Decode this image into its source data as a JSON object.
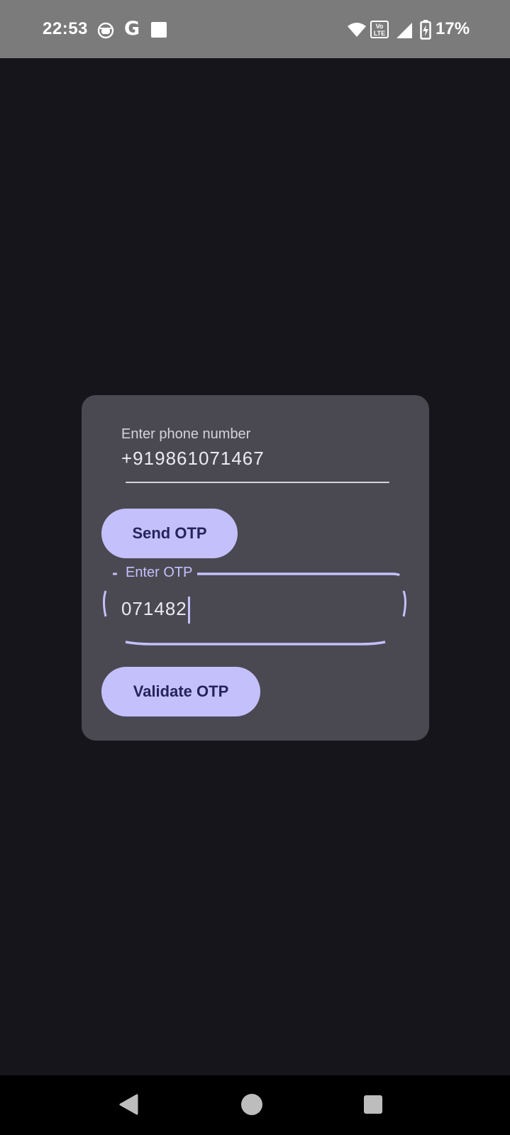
{
  "status_bar": {
    "time": "22:53",
    "battery_percent": "17%",
    "icons": [
      "face-mask-icon",
      "google-icon",
      "square-notification-icon",
      "wifi-icon",
      "volte-icon",
      "cellular-signal-icon",
      "battery-charging-icon"
    ],
    "google_letter": "G",
    "volte_text": "Vo LTE"
  },
  "form": {
    "phone_label": "Enter phone number",
    "phone_value": "+919861071467",
    "send_button": "Send OTP",
    "otp_label": "Enter OTP",
    "otp_value": "071482",
    "validate_button": "Validate OTP"
  },
  "colors": {
    "background": "#16151b",
    "card": "#4a4952",
    "accent": "#c4c0fb",
    "button_text": "#25235b"
  },
  "nav_bar": {
    "icons": [
      "back-icon",
      "home-icon",
      "recents-icon"
    ]
  }
}
